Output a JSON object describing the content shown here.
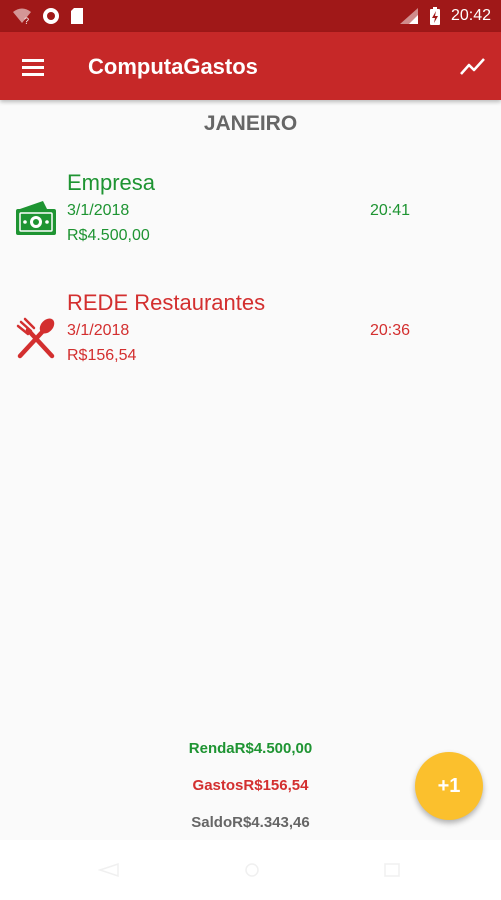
{
  "status_bar": {
    "time": "20:42"
  },
  "app_bar": {
    "title": "ComputaGastos"
  },
  "month_header": "JANEIRO",
  "entries": [
    {
      "name": "Empresa",
      "date": "3/1/2018",
      "time": "20:41",
      "amount": "R$4.500,00",
      "icon": "money-icon",
      "color": "#1e9432"
    },
    {
      "name": "REDE Restaurantes",
      "date": "3/1/2018",
      "time": "20:36",
      "amount": "R$156,54",
      "icon": "fork-spoon-icon",
      "color": "#d32f2f"
    }
  ],
  "totals": {
    "renda": "RendaR$4.500,00",
    "gastos": "GastosR$156,54",
    "saldo": "SaldoR$4.343,46"
  },
  "fab": {
    "label": "+1",
    "color": "#fbc02d"
  },
  "colors": {
    "primary": "#c62828",
    "primary_dark": "#a01818",
    "income": "#1e9432",
    "expense": "#d32f2f"
  }
}
